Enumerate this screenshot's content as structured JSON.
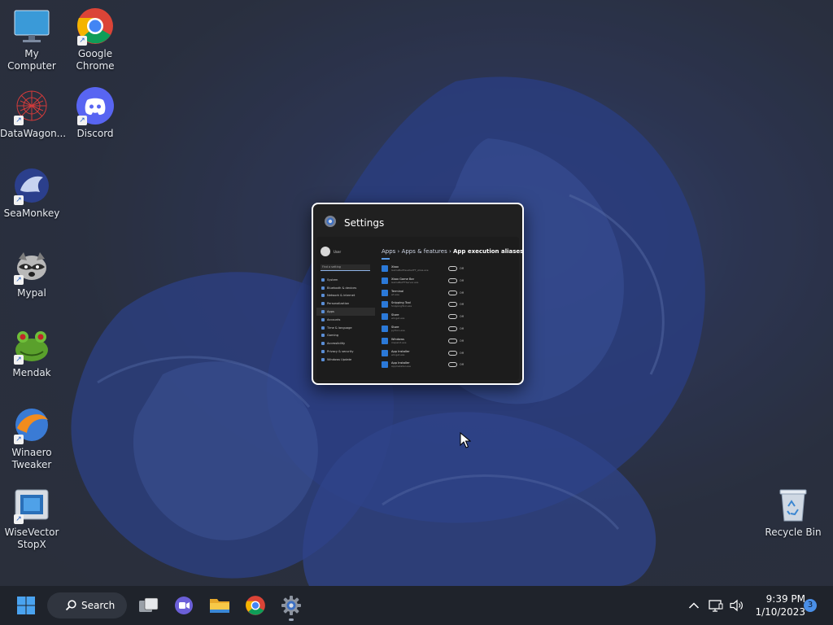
{
  "desktop_icons": [
    {
      "name": "my-computer",
      "label": "My Computer"
    },
    {
      "name": "google-chrome",
      "label": "Google\nChrome"
    },
    {
      "name": "datawagon",
      "label": "DataWagon..."
    },
    {
      "name": "discord",
      "label": "Discord"
    },
    {
      "name": "seamonkey",
      "label": "SeaMonkey"
    },
    {
      "name": "mypal",
      "label": "Mypal"
    },
    {
      "name": "mendak",
      "label": "Mendak"
    },
    {
      "name": "winaero-tweaker",
      "label": "Winaero\nTweaker"
    },
    {
      "name": "wisevector-stopx",
      "label": "WiseVector\nStopX"
    },
    {
      "name": "recycle-bin",
      "label": "Recycle Bin"
    }
  ],
  "preview": {
    "title": "Settings",
    "mini": {
      "user_name": "User",
      "find_setting": "Find a setting",
      "nav": [
        "System",
        "Bluetooth & devices",
        "Network & internet",
        "Personalization",
        "Apps",
        "Accounts",
        "Time & language",
        "Gaming",
        "Accessibility",
        "Privacy & security",
        "Windows Update"
      ],
      "crumb_apps": "Apps",
      "crumb_features": "Apps & features",
      "crumb_current": "App execution aliases",
      "aliases": [
        {
          "name": "Xbox",
          "sub": "GameBarElevatedFT_Alias.exe",
          "state": "Off"
        },
        {
          "name": "Xbox Game Bar",
          "sub": "GameBarFTServer.exe",
          "state": "Off"
        },
        {
          "name": "Terminal",
          "sub": "wt.exe",
          "state": "Off"
        },
        {
          "name": "Snipping Tool",
          "sub": "SnippingTool.exe",
          "state": "Off"
        },
        {
          "name": "Store",
          "sub": "winget.exe",
          "state": "Off"
        },
        {
          "name": "Store",
          "sub": "python.exe",
          "state": "Off"
        },
        {
          "name": "Windows",
          "sub": "mspaint.exe",
          "state": "Off"
        },
        {
          "name": "App Installer",
          "sub": "winget.exe",
          "state": "Off"
        },
        {
          "name": "App Installer",
          "sub": "AppInstaller.exe",
          "state": "Off"
        }
      ]
    }
  },
  "taskbar": {
    "search_label": "Search",
    "time": "9:39 PM",
    "date": "1/10/2023",
    "notification_count": "3"
  }
}
